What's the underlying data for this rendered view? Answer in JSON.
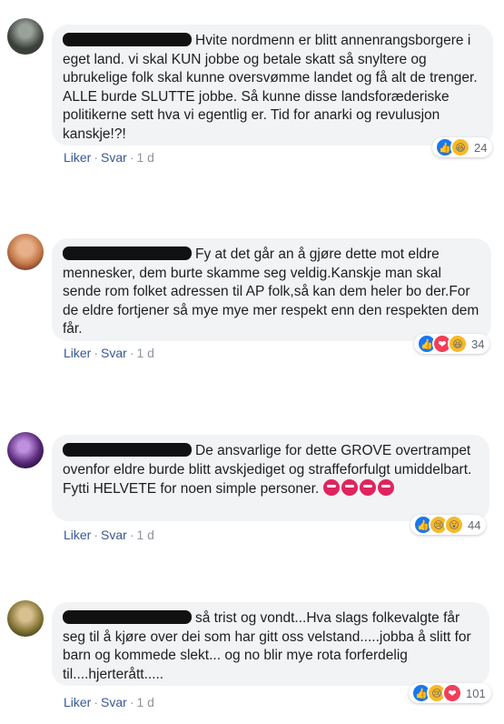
{
  "comments": [
    {
      "text": "Hvite nordmenn er blitt annenrangsborgere i eget land. vi skal KUN jobbe og betale skatt så snyltere og ubrukelige folk skal kunne oversvømme landet og få alt de trenger. ALLE burde SLUTTE jobbe. Så kunne disse landsforæderiske politikerne sett hva vi egentlig er. Tid for anarki og revulusjon kanskje!?!",
      "like_label": "Liker",
      "reply_label": "Svar",
      "time": "1 d",
      "reaction_icons": [
        "like-icon",
        "haha-icon"
      ],
      "reaction_count": "24",
      "avatar_color": "#3a3f3a"
    },
    {
      "text": "Fy at det går an å gjøre dette mot eldre mennesker, dem burte skamme seg veldig.Kanskje man skal sende rom folket adressen til AP folk,så kan dem heler bo der.For de eldre fortjener så mye mye mer respekt enn den respekten dem får.",
      "like_label": "Liker",
      "reply_label": "Svar",
      "time": "1 d",
      "reaction_icons": [
        "like-icon",
        "love-icon",
        "haha-icon"
      ],
      "reaction_count": "34",
      "avatar_color": "#c47a4a"
    },
    {
      "text": "De ansvarlige for dette GROVE overtrampet ovenfor eldre burde blitt avskjediget og straffeforfulgt umiddelbart. Fytti HELVETE for noen simple personer.",
      "emoji": [
        "angry-icon",
        "angry-icon",
        "angry-icon",
        "angry-icon"
      ],
      "like_label": "Liker",
      "reply_label": "Svar",
      "time": "1 d",
      "reaction_icons": [
        "like-icon",
        "sad-icon",
        "wow-icon"
      ],
      "reaction_count": "44",
      "avatar_color": "#5a2a7a"
    },
    {
      "text": "så trist og vondt...Hva slags folkevalgte får seg til å kjøre over dei som har gitt oss velstand.....jobba å slitt for barn og kommede slekt... og no blir mye rota forferdelig til....hjerterått.....",
      "like_label": "Liker",
      "reply_label": "Svar",
      "time": "1 d",
      "reaction_icons": [
        "like-icon",
        "sad-icon",
        "love-icon"
      ],
      "reaction_count": "101",
      "avatar_color": "#8a7a3a"
    }
  ]
}
